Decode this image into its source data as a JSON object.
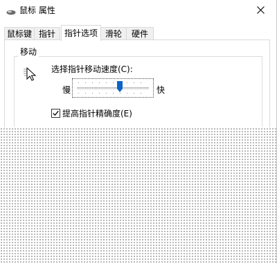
{
  "window": {
    "title": "鼠标 属性"
  },
  "tabs": [
    {
      "label": "鼠标键"
    },
    {
      "label": "指针"
    },
    {
      "label": "指针选项",
      "active": true
    },
    {
      "label": "滑轮"
    },
    {
      "label": "硬件"
    }
  ],
  "motion_group": {
    "title": "移动",
    "speed_label": "选择指针移动速度(C):",
    "slow_label": "慢",
    "fast_label": "快",
    "speed_level": 0.6,
    "precision_checkbox": {
      "label": "提高指针精确度(E)",
      "checked": true
    }
  },
  "icons": {
    "app": "mouse-icon",
    "close": "close-icon",
    "pointer": "pointer-trails-icon",
    "thumb": "slider-thumb",
    "check": "checkmark-icon"
  },
  "colors": {
    "thumb": "#0a64c8",
    "accent": "#0078d7"
  }
}
